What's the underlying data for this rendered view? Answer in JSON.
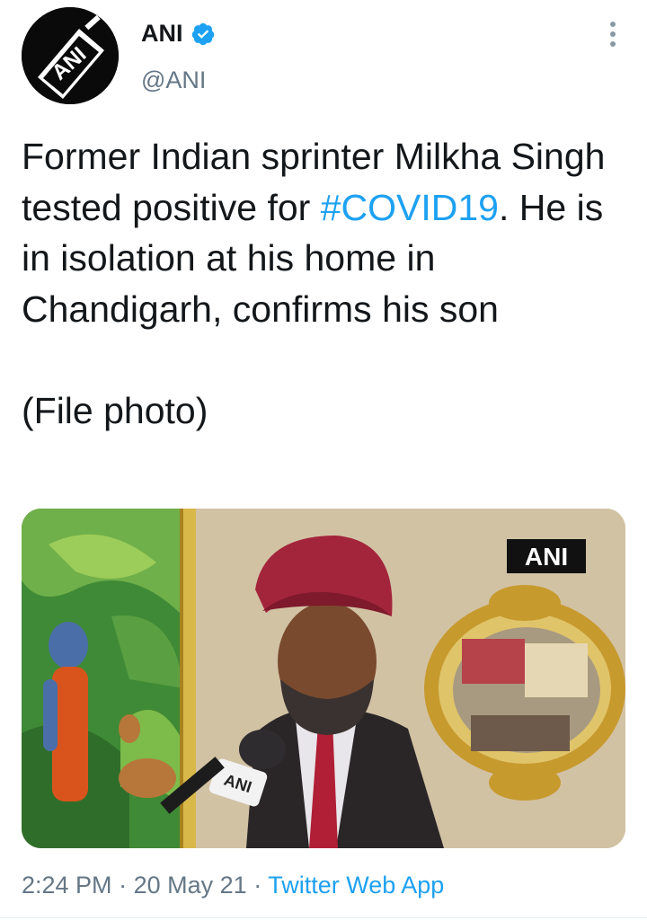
{
  "account": {
    "name": "ANI",
    "handle": "@ANI",
    "avatar_text": "ANI",
    "verified": true,
    "icons": {
      "verified": "verified-badge-icon",
      "more": "more-options-icon"
    }
  },
  "tweet": {
    "text_before_hashtag": "Former Indian sprinter Milkha Singh tested positive for ",
    "hashtag": "#COVID19",
    "text_after_hashtag": ". He is in isolation at his home in Chandigarh, confirms his son",
    "second_paragraph": "(File photo)"
  },
  "media": {
    "watermark": "ANI",
    "mic_label": "ANI"
  },
  "meta": {
    "time": "2:24 PM",
    "separator": "·",
    "date": "20 May 21",
    "source": "Twitter Web App"
  },
  "colors": {
    "link": "#1da1f2",
    "secondary_text": "#657786",
    "verified": "#1da1f2"
  }
}
